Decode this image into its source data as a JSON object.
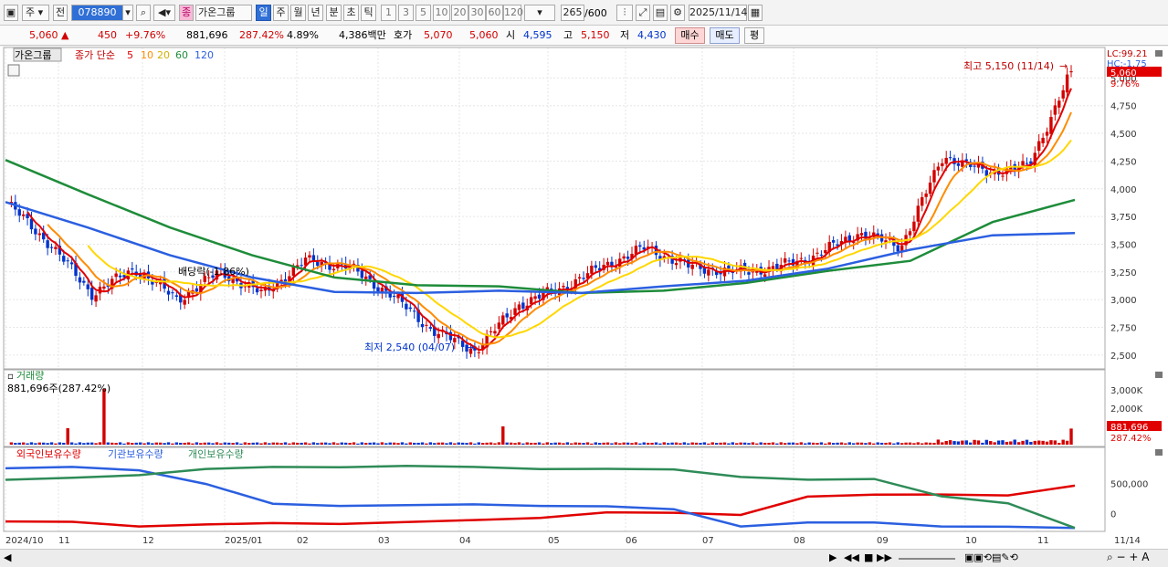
{
  "toolbar": {
    "market": "주",
    "prev_label": "전",
    "code": "078890",
    "badge": "종",
    "name": "가온그룹",
    "periods": [
      "일",
      "주",
      "월",
      "년",
      "분",
      "초",
      "틱"
    ],
    "active_period": "일",
    "intervals": [
      "1",
      "3",
      "5",
      "10",
      "20",
      "30",
      "60",
      "120"
    ],
    "count": "265",
    "total": "/600",
    "date": "2025/11/14"
  },
  "quote": {
    "price": "5,060",
    "arrow": "▲",
    "change": "450",
    "change_pct": "+9.76%",
    "volume": "881,696",
    "volume_ratio": "287.42%",
    "turnover": "4.89%",
    "amount": "4,386백만",
    "bid_label": "호가",
    "ask_price": "5,070",
    "bid_price": "5,060",
    "open_label": "시",
    "open": "4,595",
    "high_label": "고",
    "high": "5,150",
    "low_label": "저",
    "low": "4,430",
    "buy_label": "매수",
    "sell_label": "매도",
    "avg_label": "평"
  },
  "price_panel": {
    "stock_label": "가온그룹",
    "ma_title": "종가 단순",
    "ma_periods": [
      "5",
      "10",
      "20",
      "60",
      "120"
    ],
    "ma_colors": [
      "#e00000",
      "#ff8c00",
      "#ffd700",
      "#1e8c3a",
      "#2b5fe0"
    ],
    "lc_text": "LC:99.21",
    "hc_text": "HC:-1.75",
    "price_tag": "5,060",
    "pct_tag": "9.76%",
    "high_note": "최고 5,150 (11/14)",
    "low_note": "최저 2,540 (04/07)",
    "dividend_note": "배당락(-1.86%)"
  },
  "volume_panel": {
    "title": "거래량",
    "value_text": "881,696주(287.42%)",
    "tag_value": "881,696",
    "tag_pct": "287.42%"
  },
  "holdings_panel": {
    "legend": [
      "외국인보유수량",
      "기관보유수량",
      "개인보유수량"
    ],
    "colors": [
      "#e00000",
      "#2b5fe0",
      "#2e8b57"
    ]
  },
  "colors": {
    "up": "#d20000",
    "down": "#0033cc"
  },
  "chart_data": [
    {
      "type": "line",
      "title": "가온그룹 일봉",
      "x_labels": [
        "2024/10",
        "11",
        "12",
        "2025/01",
        "02",
        "03",
        "04",
        "05",
        "06",
        "07",
        "08",
        "09",
        "10",
        "11",
        "11/14"
      ],
      "y_ticks": [
        "5,000",
        "4,750",
        "4,500",
        "4,250",
        "4,000",
        "3,750",
        "3,500",
        "3,250",
        "3,000",
        "2,750",
        "2,500"
      ],
      "ylim": [
        2400,
        5250
      ],
      "close_trend": [
        {
          "x": "2024/10",
          "y": 3870
        },
        {
          "x": "11",
          "y": 3500
        },
        {
          "x": "11 mid",
          "y": 3050
        },
        {
          "x": "12",
          "y": 3280
        },
        {
          "x": "12 mid",
          "y": 3000
        },
        {
          "x": "2025/01",
          "y": 3250
        },
        {
          "x": "02",
          "y": 3050
        },
        {
          "x": "02 mid",
          "y": 3350
        },
        {
          "x": "03",
          "y": 3300
        },
        {
          "x": "03 mid",
          "y": 3050
        },
        {
          "x": "04",
          "y": 2720
        },
        {
          "x": "04/07",
          "y": 2540
        },
        {
          "x": "04 mid",
          "y": 2950
        },
        {
          "x": "05",
          "y": 3100
        },
        {
          "x": "05 mid",
          "y": 3300
        },
        {
          "x": "06",
          "y": 3470
        },
        {
          "x": "06 mid",
          "y": 3300
        },
        {
          "x": "07",
          "y": 3250
        },
        {
          "x": "08",
          "y": 3280
        },
        {
          "x": "08 mid",
          "y": 3400
        },
        {
          "x": "09",
          "y": 3600
        },
        {
          "x": "09 mid",
          "y": 3480
        },
        {
          "x": "10",
          "y": 4300
        },
        {
          "x": "10 mid",
          "y": 4150
        },
        {
          "x": "11",
          "y": 4200
        },
        {
          "x": "11/14",
          "y": 5060
        }
      ],
      "series": [
        {
          "name": "60",
          "values": [
            4260,
            3950,
            3650,
            3400,
            3200,
            3130,
            3120,
            3060,
            3080,
            3150,
            3260,
            3350,
            3700,
            3900
          ]
        },
        {
          "name": "120",
          "values": [
            3880,
            3650,
            3400,
            3200,
            3070,
            3060,
            3080,
            3060,
            3120,
            3170,
            3280,
            3450,
            3580,
            3600
          ]
        }
      ]
    },
    {
      "type": "bar",
      "title": "거래량",
      "y_ticks": [
        "3,000K",
        "2,000K"
      ],
      "highlights": [
        {
          "x": "11",
          "y": 3050000
        },
        {
          "x": "04/09",
          "y": 1000000
        },
        {
          "x": "11/14",
          "y": 881696
        }
      ]
    },
    {
      "type": "line",
      "title": "보유수량",
      "y_ticks": [
        "500,000",
        "0"
      ]
    }
  ]
}
